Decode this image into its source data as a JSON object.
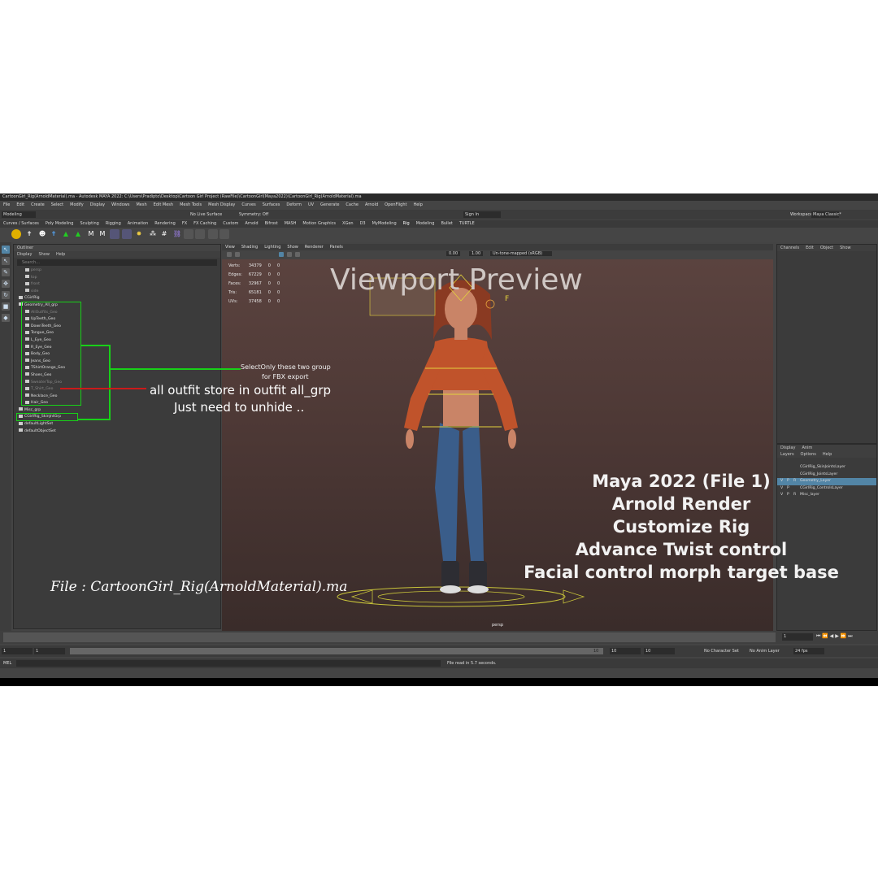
{
  "title_bar": "CartoonGirl_Rig(ArnoldMaterial).ma - Autodesk MAYA 2022: C:\\Users\\Pradipto\\Desktop\\Cartoon Girl Project (RawFile)\\CartoonGirl(Maya2022)\\CartoonGirl_Rig(ArnoldMaterial).ma",
  "menu_items": [
    "File",
    "Edit",
    "Create",
    "Select",
    "Modify",
    "Display",
    "Windows",
    "Mesh",
    "Edit Mesh",
    "Mesh Tools",
    "Mesh Display",
    "Curves",
    "Surfaces",
    "Deform",
    "UV",
    "Generate",
    "Cache",
    "Arnold",
    "OpenFlight",
    "Help"
  ],
  "workspace": {
    "label": "Workspace :",
    "value": "Maya Classic*"
  },
  "status_line": {
    "mode": "Modeling",
    "no_live_surface": "No Live Surface",
    "symmetry": "Symmetry: Off",
    "sign_in": "Sign In"
  },
  "shelf_tabs": [
    "Curves / Surfaces",
    "Poly Modeling",
    "Sculpting",
    "Rigging",
    "Animation",
    "Rendering",
    "FX",
    "FX Caching",
    "Custom",
    "Arnold",
    "Bifrost",
    "MASH",
    "Motion Graphics",
    "XGen",
    "D3",
    "MyModeling",
    "Rig",
    "Modeling",
    "Bullet",
    "TURTLE"
  ],
  "outliner": {
    "title": "Outliner",
    "menus": [
      "Display",
      "Show",
      "Help"
    ],
    "search_placeholder": "Search...",
    "items": [
      {
        "label": "persp",
        "dim": true,
        "indent": 1
      },
      {
        "label": "top",
        "dim": true,
        "indent": 1
      },
      {
        "label": "front",
        "dim": true,
        "indent": 1
      },
      {
        "label": "side",
        "dim": true,
        "indent": 1
      },
      {
        "label": "CGirlRig",
        "dim": false,
        "indent": 0
      },
      {
        "label": "Geometry_All_grp",
        "dim": false,
        "indent": 0
      },
      {
        "label": "AllOutfits_Geo",
        "dim": true,
        "indent": 1
      },
      {
        "label": "UpTeeth_Geo",
        "dim": false,
        "indent": 1
      },
      {
        "label": "DownTeeth_Geo",
        "dim": false,
        "indent": 1
      },
      {
        "label": "Tongue_Geo",
        "dim": false,
        "indent": 1
      },
      {
        "label": "L_Eye_Geo",
        "dim": false,
        "indent": 1
      },
      {
        "label": "R_Eye_Geo",
        "dim": false,
        "indent": 1
      },
      {
        "label": "Body_Geo",
        "dim": false,
        "indent": 1
      },
      {
        "label": "Jeans_Geo",
        "dim": false,
        "indent": 1
      },
      {
        "label": "TShirtOrange_Geo",
        "dim": false,
        "indent": 1
      },
      {
        "label": "Shoes_Geo",
        "dim": false,
        "indent": 1
      },
      {
        "label": "SweaterTop_Geo",
        "dim": true,
        "indent": 1
      },
      {
        "label": "T_Shirt_Geo",
        "dim": true,
        "indent": 1
      },
      {
        "label": "Necklace_Geo",
        "dim": false,
        "indent": 1
      },
      {
        "label": "Hair_Geo",
        "dim": false,
        "indent": 1
      },
      {
        "label": "Misc_grp",
        "dim": false,
        "indent": 0
      },
      {
        "label": "CGirlRig_SkinJntGrp",
        "dim": false,
        "indent": 0
      },
      {
        "label": "defaultLightSet",
        "dim": false,
        "indent": 0
      },
      {
        "label": "defaultObjectSet",
        "dim": false,
        "indent": 0
      }
    ]
  },
  "viewport": {
    "menus": [
      "View",
      "Shading",
      "Lighting",
      "Show",
      "Renderer",
      "Panels"
    ],
    "hud": [
      {
        "label": "Verts:",
        "v1": "34379",
        "v2": "0",
        "v3": "0"
      },
      {
        "label": "Edges:",
        "v1": "67229",
        "v2": "0",
        "v3": "0"
      },
      {
        "label": "Faces:",
        "v1": "32967",
        "v2": "0",
        "v3": "0"
      },
      {
        "label": "Tris:",
        "v1": "65181",
        "v2": "0",
        "v3": "0"
      },
      {
        "label": "UVs:",
        "v1": "37458",
        "v2": "0",
        "v3": "0"
      }
    ],
    "camera": "persp",
    "exposure": "0.00",
    "gamma": "1.00",
    "color_space": "Un-tone-mapped (sRGB)"
  },
  "channel_box": {
    "menus": [
      "Channels",
      "Edit",
      "Object",
      "Show"
    ]
  },
  "layer_editor": {
    "tabs": [
      "Display",
      "Anim"
    ],
    "menus": [
      "Layers",
      "Options",
      "Help"
    ],
    "layers": [
      {
        "v": "",
        "p": "",
        "r": "",
        "name": "CGirlRig_SkinJointsLayer",
        "selected": false
      },
      {
        "v": "",
        "p": "",
        "r": "",
        "name": "CGirlRig_JointsLayer",
        "selected": false
      },
      {
        "v": "V",
        "p": "P",
        "r": "R",
        "name": "Geometry_Layer",
        "selected": true
      },
      {
        "v": "V",
        "p": "P",
        "r": "",
        "name": "CGirlRig_ControlsLayer",
        "selected": false
      },
      {
        "v": "V",
        "p": "P",
        "r": "R",
        "name": "Misc_layer",
        "selected": false
      }
    ]
  },
  "timeline": {
    "start": "1",
    "end": "10",
    "range_start": "1",
    "range_start2": "1",
    "range_end": "10",
    "range_end2": "10",
    "range_end3": "10",
    "current": "1",
    "character_set": "No Character Set",
    "anim_layer": "No Anim Layer",
    "fps": "24 fps"
  },
  "command_line": {
    "label": "MEL",
    "result": "File read in 5.7 seconds."
  },
  "annotations": {
    "viewport_preview": "Viewport Preview",
    "select_note_line1": "SelectOnly these two group",
    "select_note_line2": "for FBX export",
    "outfit_note_line1": "all outfit store in outfit all_grp",
    "outfit_note_line2": "Just need to unhide ..",
    "file_name": "File : CartoonGirl_Rig(ArnoldMaterial).ma",
    "features": [
      "Maya 2022 (File 1)",
      "Arnold Render",
      "Customize Rig",
      "Advance Twist control",
      "Facial control morph target base"
    ]
  },
  "colors": {
    "annotation_green": "#18d018",
    "annotation_red": "#cc1a1a",
    "selection_blue": "#5285a6"
  }
}
